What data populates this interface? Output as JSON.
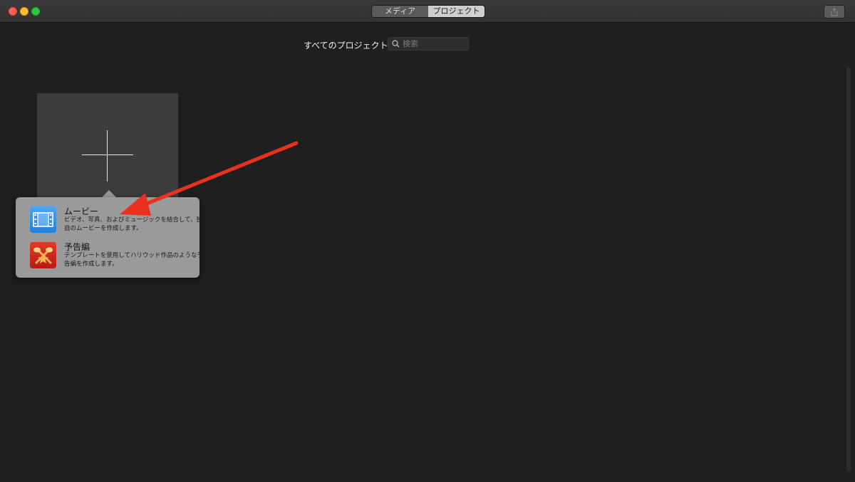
{
  "toolbar": {
    "tabs": [
      {
        "label": "メディア",
        "selected": false
      },
      {
        "label": "プロジェクト",
        "selected": true
      }
    ],
    "share_icon": "share-icon"
  },
  "filter": {
    "label": "すべてのプロジェクト",
    "chevron_icon": "up-down-chevron-icon"
  },
  "search": {
    "placeholder": "検索",
    "icon": "search-icon"
  },
  "new_project": {
    "icon": "plus-icon"
  },
  "popover": {
    "items": [
      {
        "title": "ムービー",
        "description": "ビデオ、写真、およびミュージックを結合して、独自のムービーを作成します。",
        "icon": "film-strip-icon"
      },
      {
        "title": "予告編",
        "description": "テンプレートを使用してハリウッド作品のような予告編を作成します。",
        "icon": "spotlight-star-icon"
      }
    ]
  },
  "colors": {
    "background": "#1f1f1f",
    "titlebar": "#363636",
    "tile": "#3c3c3c",
    "popover": "#9a9a9a",
    "annotation_arrow": "#e8321e"
  }
}
